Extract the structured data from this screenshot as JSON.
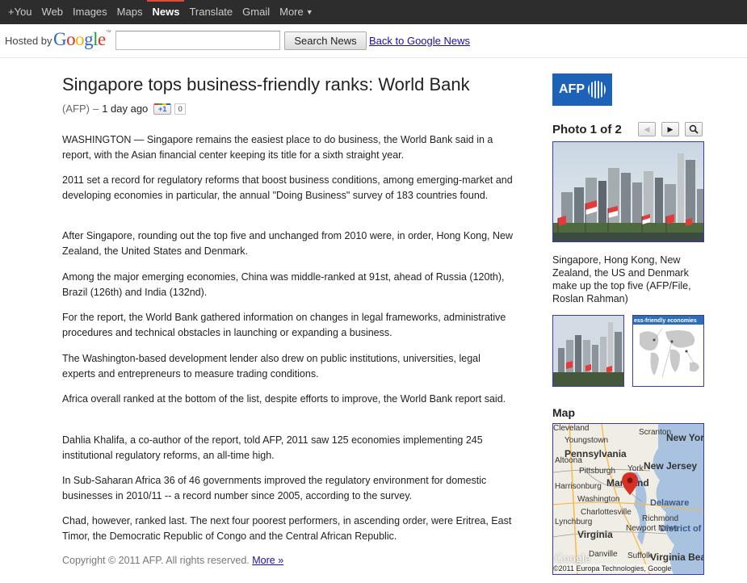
{
  "topnav": [
    {
      "label": "+You"
    },
    {
      "label": "Web"
    },
    {
      "label": "Images"
    },
    {
      "label": "Maps"
    },
    {
      "label": "News",
      "active": true
    },
    {
      "label": "Translate"
    },
    {
      "label": "Gmail"
    },
    {
      "label": "More"
    }
  ],
  "header": {
    "hosted_by": "Hosted by",
    "logo_letters": [
      "G",
      "o",
      "o",
      "g",
      "l",
      "e"
    ],
    "logo_colors": [
      "#3366cc",
      "#dd3322",
      "#f5b400",
      "#3366cc",
      "#229944",
      "#dd3322"
    ],
    "search_value": "",
    "search_button": "Search News",
    "back_link": "Back to Google News"
  },
  "article": {
    "title": "Singapore tops business-friendly ranks: World Bank",
    "source": "(AFP)",
    "separator": "–",
    "time": "1 day ago",
    "plusone_label": "+1",
    "plusone_count": "0",
    "paragraphs": [
      "WASHINGTON — Singapore remains the easiest place to do business, the World Bank said in a report, with the Asian financial center keeping its title for a sixth straight year.",
      "2011 set a record for regulatory reforms that boost business conditions, among emerging-market and developing economies in particular, the annual \"Doing Business\" survey of 183 countries found.",
      "After Singapore, rounding out the top five and unchanged from 2010 were, in order, Hong Kong, New Zealand, the United States and Denmark.",
      "Among the major emerging economies, China was middle-ranked at 91st, ahead of Russia (120th), Brazil (126th) and India (132nd).",
      "For the report, the World Bank gathered information on changes in legal frameworks, administrative procedures and technical obstacles in launching or expanding a business.",
      "The Washington-based development lender also drew on public institutions, universities, legal experts and entrepreneurs to measure trading conditions.",
      "Africa overall ranked at the bottom of the list, despite efforts to improve, the World Bank report said.",
      "Dahlia Khalifa, a co-author of the report, told AFP, 2011 saw 125 economies implementing 245 institutional regulatory reforms, an all-time high.",
      "In Sub-Saharan Africa 36 of 46 governments improved the regulatory environment for domestic businesses in 2010/11 -- a record number since 2005, according to the survey.",
      "Chad, however, ranked last. The next four poorest performers, in ascending order, were Eritrea, East Timor, the Democratic Republic of Congo and the Central African Republic."
    ],
    "copyright": "Copyright © 2011 AFP. All rights reserved.",
    "more_link": "More »"
  },
  "sidebar": {
    "afp_logo": "AFP",
    "photo_counter": "Photo 1 of 2",
    "photo_caption": "Singapore, Hong Kong, New Zealand, the US and Denmark make up the top five (AFP/File, Roslan Rahman)",
    "thumb2_title": "ess-friendly economies",
    "map_label": "Map",
    "map_places": [
      "Cleveland",
      "Youngstown",
      "Scranton",
      "New York",
      "Pennsylvania",
      "Pittsburgh",
      "York",
      "New Jersey",
      "Maryland",
      "Washington",
      "Charlottesville",
      "Delaware",
      "Virginia",
      "Newport News",
      "District of Columbia",
      "Richmond",
      "Danville",
      "Suffolk",
      "Virginia Beach",
      "Lynchburg",
      "Harrisonburg",
      "Altoona"
    ],
    "map_credit": "©2011 Europa Technologies, Google",
    "map_logo": "Google"
  },
  "colors": {
    "topbar_bg": "#2d2d2d",
    "active_accent": "#dd4b39",
    "link": "#1a0dab",
    "afp_blue": "#1c62b9",
    "map_pin": "#d93025"
  }
}
